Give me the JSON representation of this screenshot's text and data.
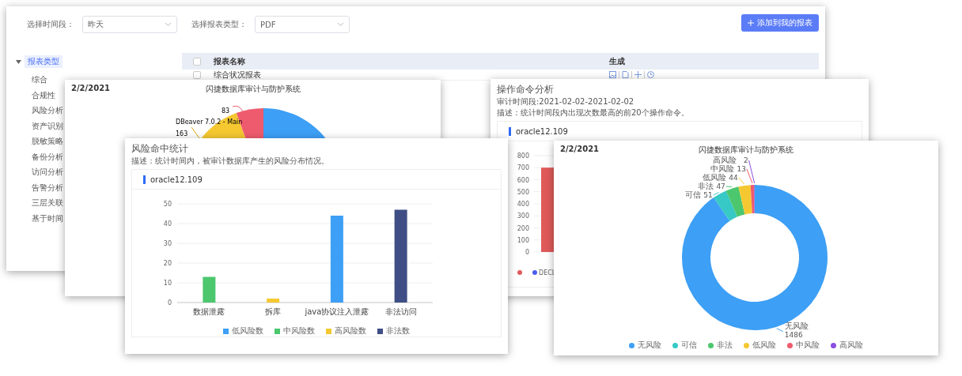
{
  "main_window": {
    "filters": [
      {
        "label": "选择时间段：",
        "value": "昨天"
      },
      {
        "label": "选择报表类型：",
        "value": "PDF"
      }
    ],
    "add_button": "添加到我的报表",
    "tree": {
      "label": "报表类型",
      "expanded": true,
      "selected": true,
      "children": [
        {
          "label": "综合",
          "selected": false
        },
        {
          "label": "合规性",
          "selected": false
        },
        {
          "label": "风险分析",
          "selected": false
        },
        {
          "label": "资产识别",
          "selected": false
        },
        {
          "label": "脱敏策略",
          "selected": false
        },
        {
          "label": "备份分析",
          "selected": false
        },
        {
          "label": "访问分析",
          "selected": false
        },
        {
          "label": "告警分析",
          "selected": false
        },
        {
          "label": "三层关联",
          "selected": false
        },
        {
          "label": "基于时间",
          "selected": false
        }
      ]
    },
    "table": {
      "columns": [
        "报表名称",
        "生成"
      ],
      "header_checked": false,
      "rows": [
        {
          "name": "综合状况报表",
          "checked": false
        }
      ]
    }
  },
  "pie_window": {
    "date": "2/2/2021",
    "title": "闪捷数据库审计与防护系统",
    "labels": [
      "83",
      "DBeaver 7.0.2 - Main",
      "163"
    ]
  },
  "command_window": {
    "title": "操作命令分析",
    "audit_time": "审计时间段:2021-02-02-2021-02-02",
    "description": "描述：统计时间段内出现次数最高的前20个操作命令。",
    "database": "oracle12.109",
    "chart_data": {
      "type": "bar",
      "values": [
        700
      ],
      "ylim": [
        0,
        800
      ],
      "yticks": [
        0,
        100,
        200,
        300,
        400,
        500,
        600,
        700,
        800
      ],
      "grid": true
    },
    "legend": [
      {
        "color": "#e05a5a"
      },
      {
        "color": "#4a5cf0",
        "label": "DECL"
      }
    ]
  },
  "risk_window": {
    "title": "风险命中统计",
    "description": "描述：统计时间内，被审计数据库产生的风险分布情况。",
    "database": "oracle12.109",
    "chart_data": {
      "type": "bar",
      "categories": [
        "数据泄露",
        "拆库",
        "java协议注入泄露",
        "非法访问"
      ],
      "ylim": [
        0,
        50
      ],
      "yticks": [
        0,
        10,
        20,
        30,
        40,
        50
      ],
      "grid": true,
      "legend": "bottom",
      "series": [
        {
          "name": "低风险数",
          "color": "#3d9ff5",
          "values": [
            null,
            null,
            44,
            null
          ]
        },
        {
          "name": "中风险数",
          "color": "#4cc76e",
          "values": [
            13,
            null,
            null,
            null
          ]
        },
        {
          "name": "高风险数",
          "color": "#f5c832",
          "values": [
            null,
            2,
            null,
            null
          ]
        },
        {
          "name": "非法数",
          "color": "#3f4e85",
          "values": [
            null,
            null,
            null,
            47
          ]
        }
      ]
    }
  },
  "donut_window": {
    "date": "2/2/2021",
    "title": "闪捷数据库审计与防护系统",
    "chart_data": {
      "type": "donut",
      "data_labels": true,
      "legend": "bottom",
      "categories": [
        "无风险",
        "可信",
        "非法",
        "低风险",
        "中风险",
        "高风险"
      ],
      "values": [
        1486,
        51,
        47,
        44,
        13,
        2
      ],
      "colors": [
        "#3d9ff5",
        "#36c9c6",
        "#4cc76e",
        "#f5c832",
        "#ef5b6e",
        "#8a4fe0"
      ]
    }
  }
}
